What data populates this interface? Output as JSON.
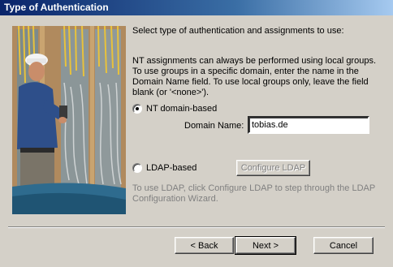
{
  "window": {
    "title": "Type of Authentication"
  },
  "content": {
    "intro": "Select type of authentication and assignments to use:",
    "description": "NT assignments can always be performed using local groups.  To use groups in a specific domain, enter the name in the Domain Name field.  To use local groups only, leave the field blank (or '<none>').",
    "nt_option": {
      "label": "NT domain-based",
      "selected": true
    },
    "domain_field": {
      "label": "Domain Name:",
      "value": "tobias.de"
    },
    "ldap_option": {
      "label": "LDAP-based",
      "selected": false
    },
    "configure_ldap_label": "Configure LDAP",
    "ldap_help": "To use LDAP, click Configure LDAP to step through the LDAP Configuration Wizard."
  },
  "buttons": {
    "back": "< Back",
    "next": "Next >",
    "cancel": "Cancel"
  },
  "image": {
    "subject": "technician-with-wiring-panel"
  }
}
